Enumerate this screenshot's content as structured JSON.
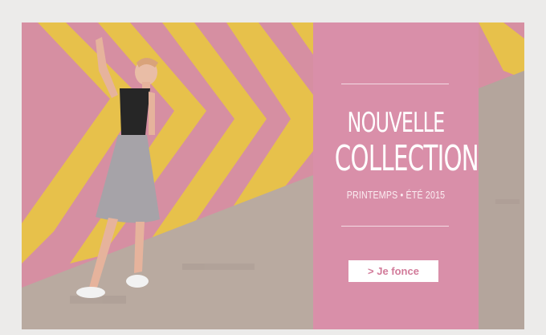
{
  "banner": {
    "title_line1": "NOUVELLE",
    "title_line2": "COLLECTION",
    "subtitle": "PRINTEMPS • ÉTÉ 2015",
    "cta_label": "> Je fonce",
    "colors": {
      "panel": "#d98fa9",
      "wall_pink": "#d68fa2",
      "chevron_yellow": "#e7c14b",
      "floor": "#b9aaa0",
      "cta_text": "#d27b9a"
    }
  }
}
